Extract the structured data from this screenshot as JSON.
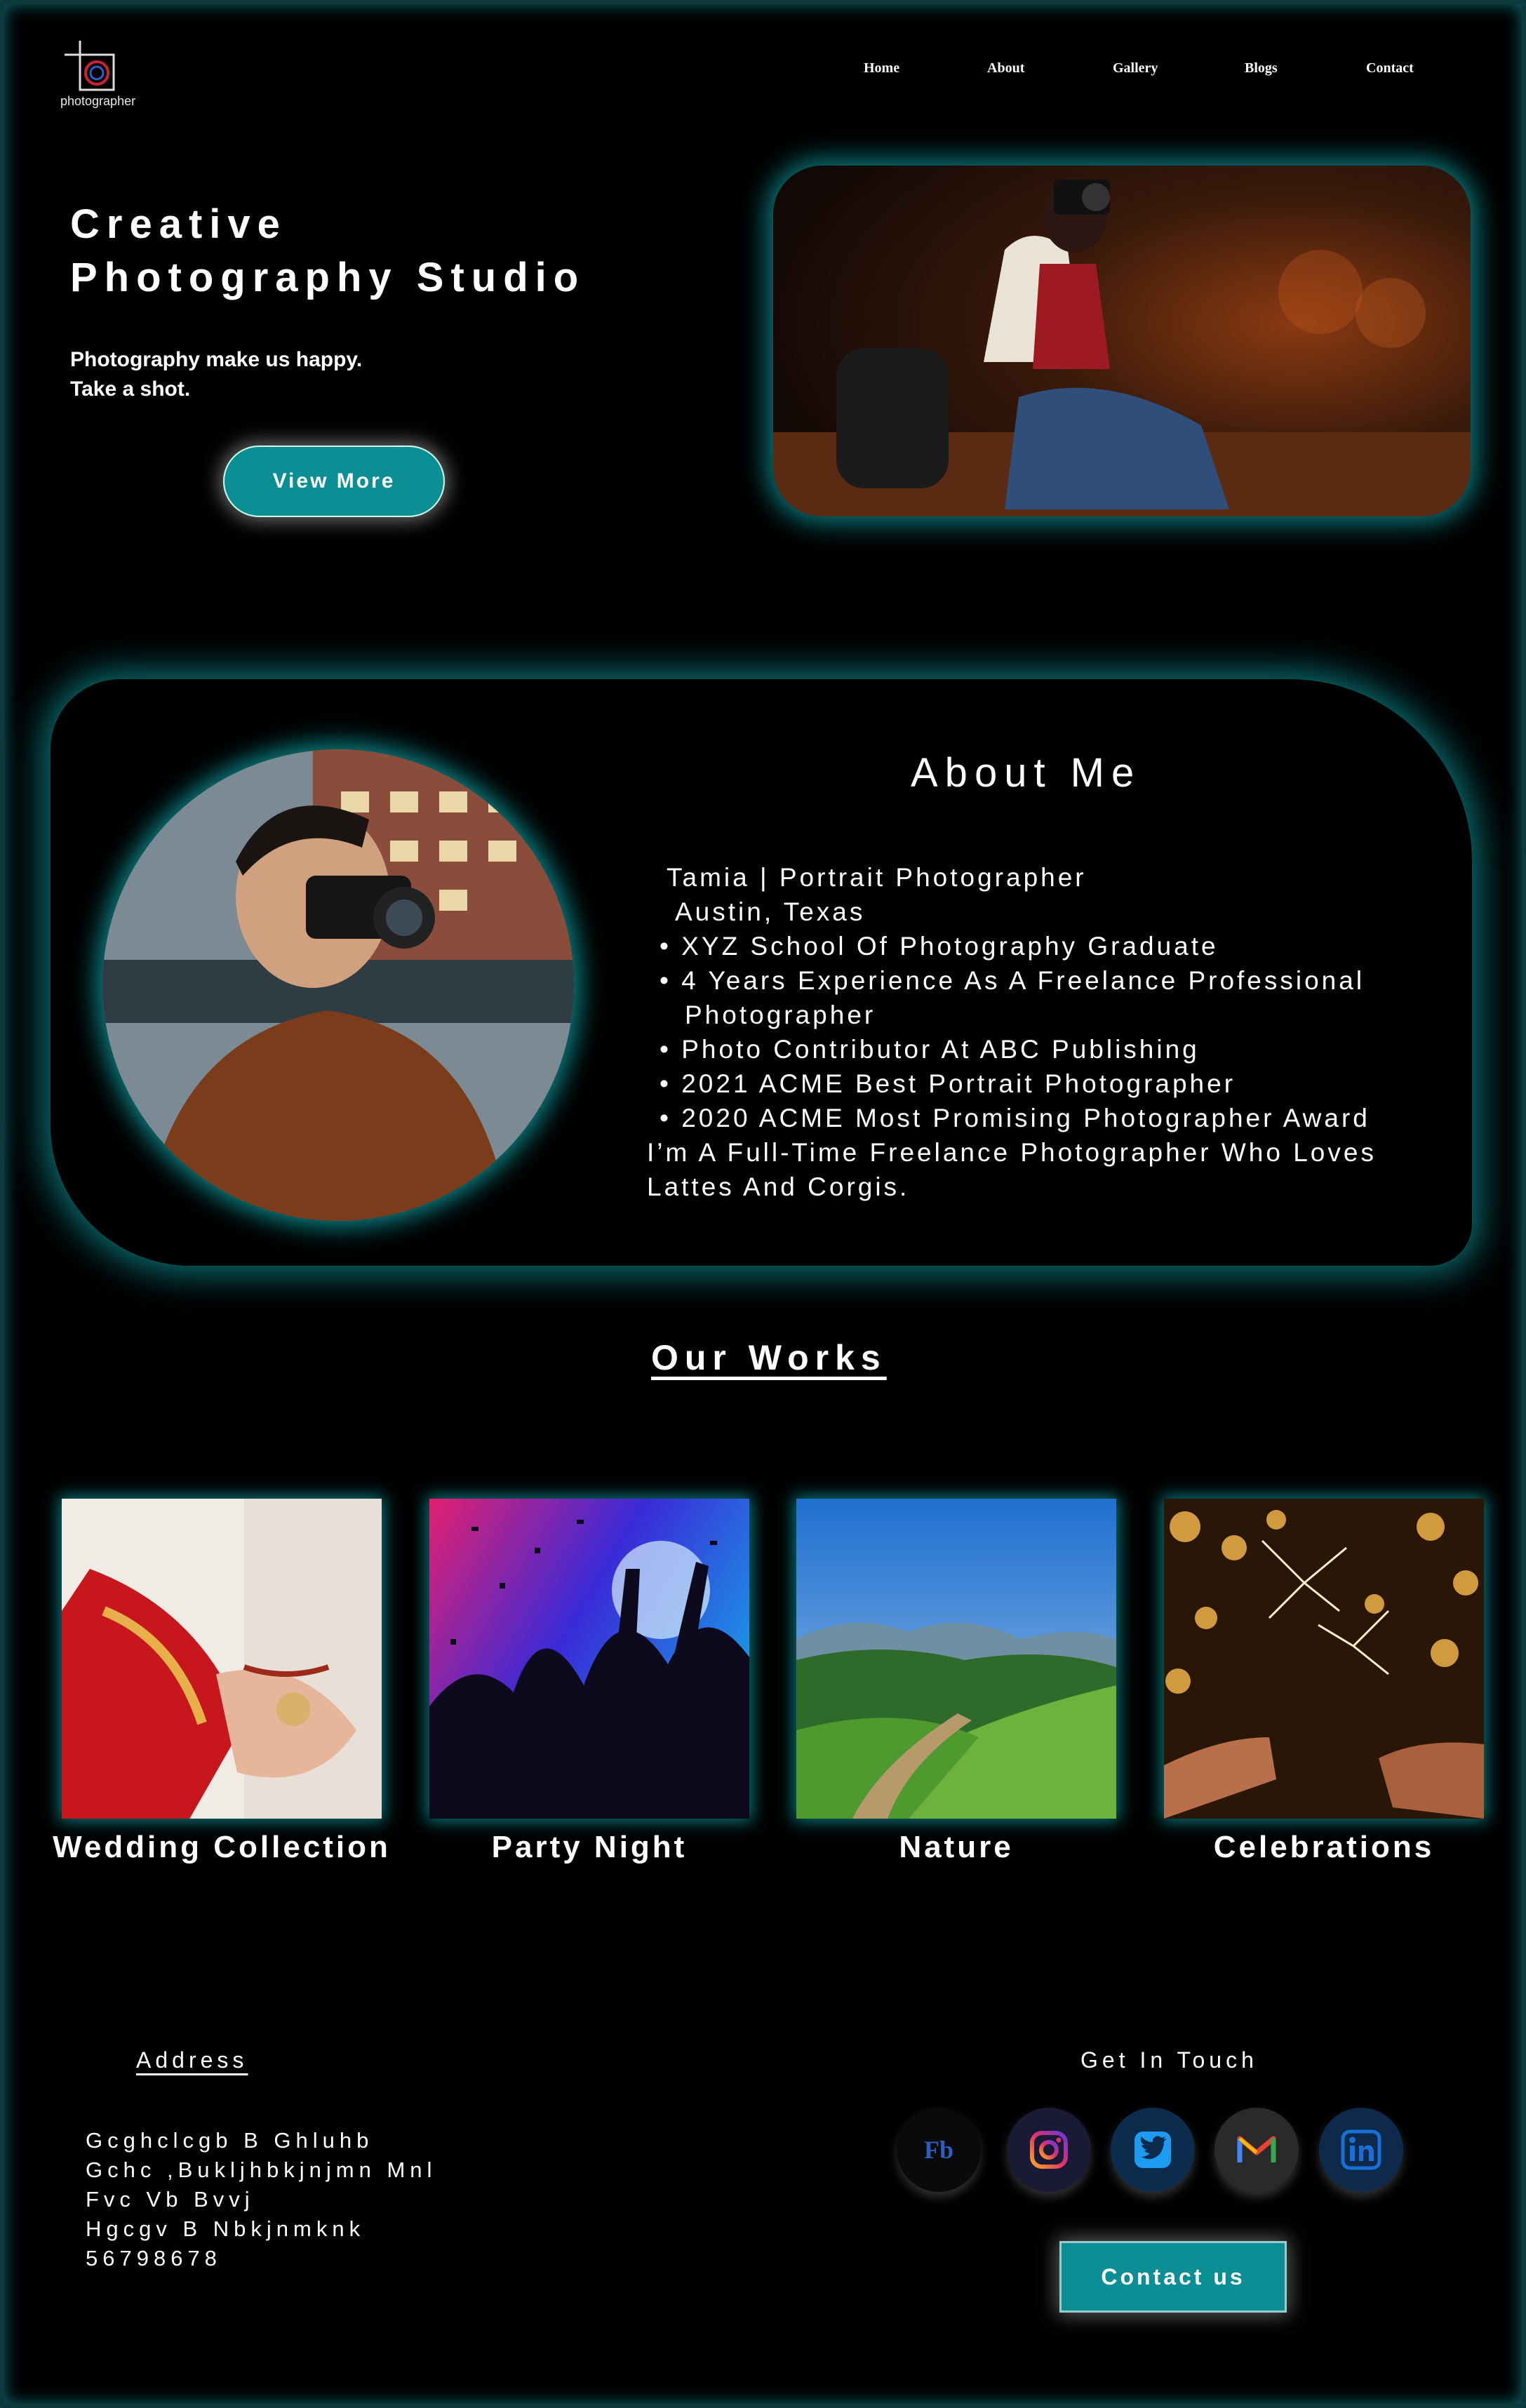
{
  "header": {
    "logo_text": "photographer",
    "nav": [
      "Home",
      "About",
      "Gallery",
      "Blogs",
      "Contact"
    ]
  },
  "hero": {
    "title_line1": "Creative",
    "title_line2": "Photography Studio",
    "subtitle_line1": "Photography make us happy.",
    "subtitle_line2": "Take a shot.",
    "button": "View More"
  },
  "about": {
    "title": "About Me",
    "lines": [
      "Tamia | Portrait Photographer",
      "Austin, Texas",
      "• XYZ School Of Photography Graduate",
      "• 4 Years Experience As A Freelance Professional",
      "Photographer",
      "• Photo Contributor At ABC Publishing",
      "• 2021 ACME Best Portrait Photographer",
      "• 2020 ACME Most Promising Photographer Award",
      "I’m A Full-Time Freelance Photographer Who Loves",
      "Lattes And Corgis."
    ]
  },
  "works": {
    "title": "Our Works",
    "items": [
      "Wedding Collection",
      "Party Night",
      "Nature",
      "Celebrations"
    ]
  },
  "footer": {
    "address_title": "Address",
    "address_lines": [
      "Gcghclcgb B Ghluhb",
      "Gchc ,Bukljhbkjnjmn Mnl",
      "Fvc Vb Bvvj",
      "Hgcgv B Nbkjnmknk",
      "56798678"
    ],
    "touch_title": "Get In Touch",
    "social": [
      "facebook-icon",
      "instagram-icon",
      "twitter-icon",
      "gmail-icon",
      "linkedin-icon"
    ],
    "fb_text": "Fb",
    "contact_button": "Contact us"
  },
  "colors": {
    "accent": "#0b8f94",
    "glow": "#0e969b",
    "background": "#000000"
  }
}
